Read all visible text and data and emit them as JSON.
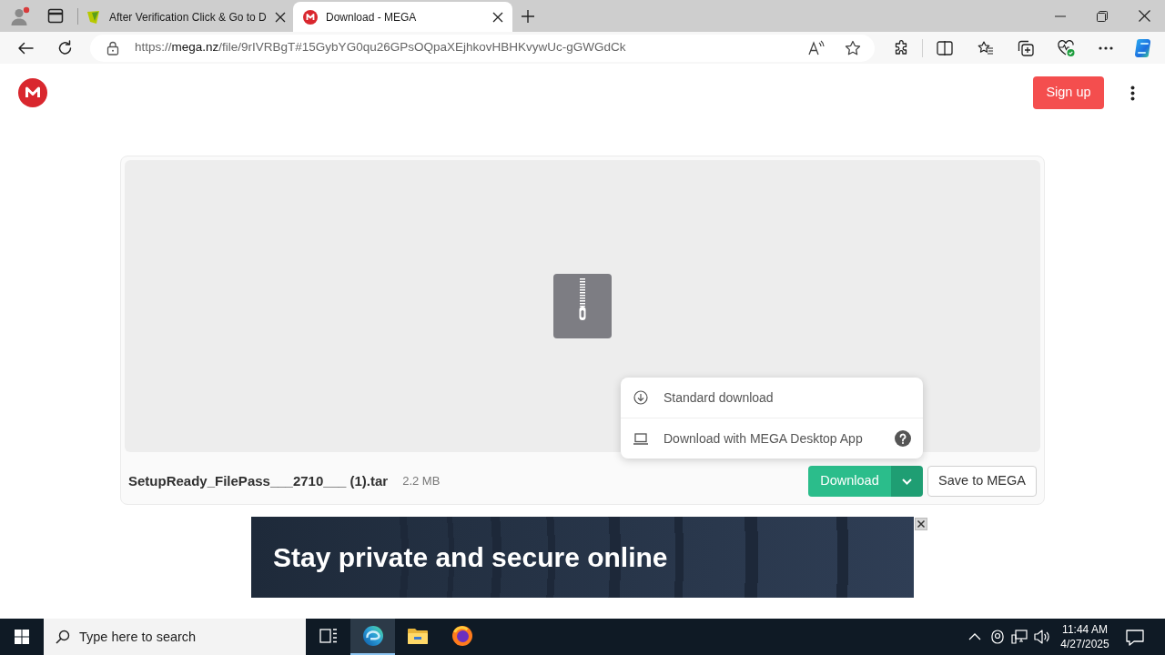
{
  "browser": {
    "tabs": [
      {
        "kind": "site",
        "title": "After Verification Click & Go to D",
        "selected": false
      },
      {
        "kind": "mega",
        "title": "Download - MEGA",
        "selected": true
      }
    ],
    "address": {
      "scheme": "https://",
      "host": "mega.nz",
      "path": "/file/9rIVRBgT#15GybYG0qu26GPsOQpaXEjhkovHBHKvywUc-gGWGdCk"
    }
  },
  "page": {
    "header": {
      "sign_up": "Sign up"
    },
    "file": {
      "name": "SetupReady_FilePass___2710___ (1).tar",
      "size": "2.2 MB"
    },
    "actions": {
      "download": "Download",
      "menu_expanded": true,
      "save": "Save to MEGA"
    },
    "download_menu": [
      {
        "kind": "standard",
        "label": "Standard download"
      },
      {
        "kind": "desktop_app",
        "label": "Download with MEGA Desktop App"
      }
    ],
    "ad": {
      "headline": "Stay private and secure online"
    }
  },
  "taskbar": {
    "search": {
      "placeholder": "Type here to search"
    },
    "apps": [
      {
        "kind": "task_view",
        "selected": false
      },
      {
        "kind": "edge",
        "selected": true
      },
      {
        "kind": "explorer",
        "selected": false
      },
      {
        "kind": "firefox",
        "selected": false
      }
    ],
    "clock": {
      "time": "11:44 AM",
      "date": "4/27/2025"
    }
  }
}
